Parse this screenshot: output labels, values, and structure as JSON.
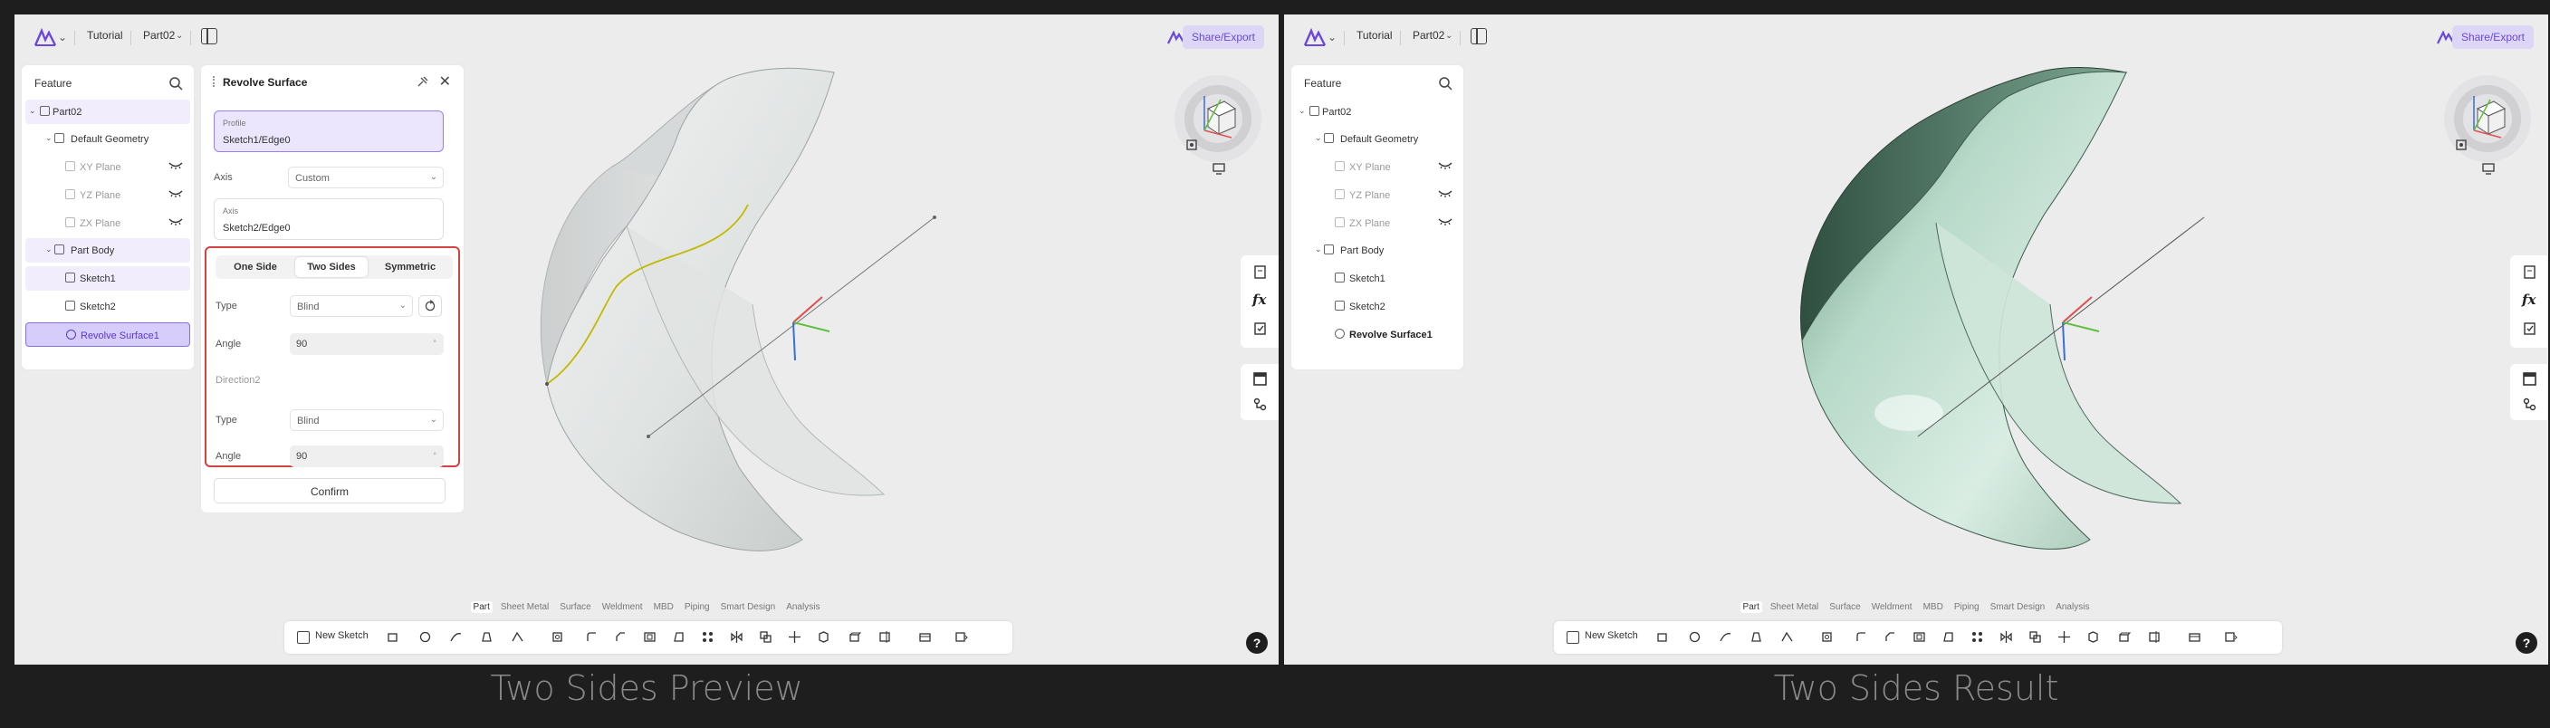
{
  "topbar": {
    "breadcrumb": [
      "Tutorial",
      "Part02"
    ],
    "share_label": "Share/Export"
  },
  "feature": {
    "title": "Feature",
    "tree": [
      {
        "label": "Part02"
      },
      {
        "label": "Default Geometry"
      },
      {
        "label": "XY Plane"
      },
      {
        "label": "YZ Plane"
      },
      {
        "label": "ZX Plane"
      },
      {
        "label": "Part Body"
      },
      {
        "label": "Sketch1"
      },
      {
        "label": "Sketch2"
      },
      {
        "label": "Revolve Surface1"
      }
    ]
  },
  "revolve": {
    "title": "Revolve Surface",
    "profile_label": "Profile",
    "profile_value": "Sketch1/Edge0",
    "axis_label": "Axis",
    "axis_value": "Custom",
    "axis_field_label": "Axis",
    "axis_field_value": "Sketch2/Edge0",
    "modes": [
      "One Side",
      "Two Sides",
      "Symmetric"
    ],
    "active_mode": "Two Sides",
    "type_label": "Type",
    "type_value": "Blind",
    "angle_label": "Angle",
    "angle_value": "90",
    "direction2_label": "Direction2",
    "type2_label": "Type",
    "type2_value": "Blind",
    "angle2_label": "Angle",
    "angle2_value": "90",
    "confirm_label": "Confirm"
  },
  "bottom": {
    "tabs": [
      "Part",
      "Sheet Metal",
      "Surface",
      "Weldment",
      "MBD",
      "Piping",
      "Smart Design",
      "Analysis"
    ],
    "active_tab": "Part",
    "new_sketch_label": "New Sketch"
  },
  "help_label": "?",
  "captions": {
    "left": "Two Sides Preview",
    "right": "Two Sides Result"
  },
  "colors": {
    "accent": "#6b47dd",
    "highlight_border": "#d64242",
    "result_surface": "#c9e3d6"
  },
  "icons": [
    "logo-icon",
    "layout-icon",
    "search-icon",
    "eye-icon",
    "pin-icon",
    "close-icon",
    "view-cube-icon",
    "fit-view-icon",
    "screen-icon",
    "fx-icon",
    "clipboard-check-icon",
    "panel-icon",
    "branch-icon",
    "help-icon"
  ]
}
